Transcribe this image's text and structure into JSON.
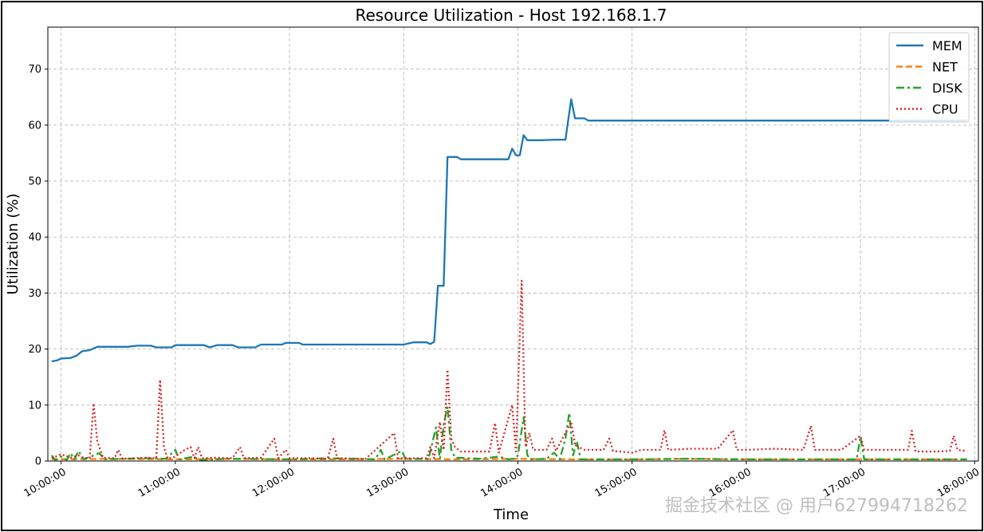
{
  "chart_data": {
    "type": "line",
    "title": "Resource Utilization - Host 192.168.1.7",
    "xlabel": "Time",
    "ylabel": "Utilization (%)",
    "ylim": [
      0,
      77.5
    ],
    "xlim": [
      "09:53:00",
      "18:02:00"
    ],
    "yticks": [
      0,
      10,
      20,
      30,
      40,
      50,
      60,
      70
    ],
    "xticks": [
      "10:00:00",
      "11:00:00",
      "12:00:00",
      "13:00:00",
      "14:00:00",
      "15:00:00",
      "16:00:00",
      "17:00:00",
      "18:00:00"
    ],
    "grid": true,
    "legend_position": "top-right",
    "series": [
      {
        "name": "MEM",
        "color": "#1f77b4",
        "style": "solid",
        "points": [
          [
            "09:55:00",
            17.8
          ],
          [
            "09:58:00",
            18.0
          ],
          [
            "10:00:00",
            18.3
          ],
          [
            "10:05:00",
            18.4
          ],
          [
            "10:08:00",
            18.8
          ],
          [
            "10:11:00",
            19.6
          ],
          [
            "10:15:00",
            19.8
          ],
          [
            "10:19:00",
            20.4
          ],
          [
            "10:25:00",
            20.4
          ],
          [
            "10:35:00",
            20.4
          ],
          [
            "10:40:00",
            20.6
          ],
          [
            "10:47:00",
            20.6
          ],
          [
            "10:50:00",
            20.3
          ],
          [
            "10:58:00",
            20.3
          ],
          [
            "11:00:00",
            20.7
          ],
          [
            "11:15:00",
            20.7
          ],
          [
            "11:18:00",
            20.3
          ],
          [
            "11:22:00",
            20.7
          ],
          [
            "11:30:00",
            20.7
          ],
          [
            "11:33:00",
            20.3
          ],
          [
            "11:42:00",
            20.3
          ],
          [
            "11:45:00",
            20.8
          ],
          [
            "11:56:00",
            20.8
          ],
          [
            "11:58:00",
            21.1
          ],
          [
            "12:05:00",
            21.1
          ],
          [
            "12:07:00",
            20.8
          ],
          [
            "12:30:00",
            20.8
          ],
          [
            "13:00:00",
            20.8
          ],
          [
            "13:05:00",
            21.2
          ],
          [
            "13:12:00",
            21.2
          ],
          [
            "13:14:00",
            20.9
          ],
          [
            "13:16:00",
            21.3
          ],
          [
            "13:18:00",
            31.3
          ],
          [
            "13:21:00",
            31.3
          ],
          [
            "13:23:00",
            54.3
          ],
          [
            "13:28:00",
            54.3
          ],
          [
            "13:30:00",
            53.9
          ],
          [
            "13:55:00",
            53.9
          ],
          [
            "13:57:00",
            55.8
          ],
          [
            "13:59:00",
            54.6
          ],
          [
            "14:01:00",
            54.6
          ],
          [
            "14:03:00",
            58.2
          ],
          [
            "14:05:00",
            57.3
          ],
          [
            "14:12:00",
            57.3
          ],
          [
            "14:20:00",
            57.4
          ],
          [
            "14:25:00",
            57.4
          ],
          [
            "14:28:00",
            64.6
          ],
          [
            "14:30:00",
            61.2
          ],
          [
            "14:35:00",
            61.2
          ],
          [
            "14:37:00",
            60.8
          ],
          [
            "15:00:00",
            60.8
          ],
          [
            "15:30:00",
            60.8
          ],
          [
            "16:00:00",
            60.8
          ],
          [
            "16:30:00",
            60.8
          ],
          [
            "17:00:00",
            60.8
          ],
          [
            "17:30:00",
            60.8
          ],
          [
            "17:56:00",
            60.8
          ]
        ]
      },
      {
        "name": "NET",
        "color": "#ff7f0e",
        "style": "dashed",
        "points": [
          [
            "09:55:00",
            0.3
          ],
          [
            "10:30:00",
            0.4
          ],
          [
            "11:00:00",
            0.3
          ],
          [
            "11:30:00",
            0.4
          ],
          [
            "12:00:00",
            0.3
          ],
          [
            "12:30:00",
            0.3
          ],
          [
            "13:00:00",
            0.4
          ],
          [
            "13:30:00",
            0.3
          ],
          [
            "14:00:00",
            0.4
          ],
          [
            "14:30:00",
            0.3
          ],
          [
            "15:00:00",
            0.3
          ],
          [
            "15:30:00",
            0.4
          ],
          [
            "16:00:00",
            0.3
          ],
          [
            "16:30:00",
            0.3
          ],
          [
            "17:00:00",
            0.3
          ],
          [
            "17:30:00",
            0.3
          ],
          [
            "17:56:00",
            0.3
          ]
        ]
      },
      {
        "name": "DISK",
        "color": "#2ca02c",
        "style": "dashdot",
        "points": [
          [
            "09:55:00",
            1.0
          ],
          [
            "09:57:00",
            0.2
          ],
          [
            "10:00:00",
            0.8
          ],
          [
            "10:03:00",
            0.2
          ],
          [
            "10:05:00",
            1.4
          ],
          [
            "10:07:00",
            0.3
          ],
          [
            "10:09:00",
            1.8
          ],
          [
            "10:12:00",
            0.3
          ],
          [
            "10:20:00",
            1.4
          ],
          [
            "10:23:00",
            0.3
          ],
          [
            "10:45:00",
            0.5
          ],
          [
            "10:55:00",
            0.4
          ],
          [
            "11:00:00",
            2.0
          ],
          [
            "11:02:00",
            0.3
          ],
          [
            "11:10:00",
            0.8
          ],
          [
            "11:12:00",
            0.2
          ],
          [
            "11:30:00",
            0.4
          ],
          [
            "12:00:00",
            0.3
          ],
          [
            "12:20:00",
            0.5
          ],
          [
            "12:45:00",
            0.3
          ],
          [
            "12:48:00",
            2.0
          ],
          [
            "12:50:00",
            0.3
          ],
          [
            "12:59:00",
            1.8
          ],
          [
            "13:01:00",
            0.3
          ],
          [
            "13:10:00",
            0.4
          ],
          [
            "13:13:00",
            0.3
          ],
          [
            "13:17:00",
            6.0
          ],
          [
            "13:19:00",
            0.4
          ],
          [
            "13:21:00",
            6.5
          ],
          [
            "13:23:00",
            9.7
          ],
          [
            "13:25:00",
            2.0
          ],
          [
            "13:27:00",
            0.6
          ],
          [
            "13:40:00",
            0.4
          ],
          [
            "13:50:00",
            0.8
          ],
          [
            "13:55:00",
            0.3
          ],
          [
            "13:58:00",
            0.4
          ],
          [
            "14:00:00",
            1.0
          ],
          [
            "14:03:00",
            7.8
          ],
          [
            "14:05:00",
            1.0
          ],
          [
            "14:07:00",
            0.3
          ],
          [
            "14:15:00",
            0.4
          ],
          [
            "14:19:00",
            1.5
          ],
          [
            "14:22:00",
            0.3
          ],
          [
            "14:25:00",
            4.0
          ],
          [
            "14:27:00",
            8.6
          ],
          [
            "14:29:00",
            1.0
          ],
          [
            "14:31:00",
            3.5
          ],
          [
            "14:33:00",
            0.3
          ],
          [
            "15:00:00",
            0.3
          ],
          [
            "15:30:00",
            0.4
          ],
          [
            "16:00:00",
            0.3
          ],
          [
            "16:30:00",
            0.3
          ],
          [
            "16:58:00",
            0.3
          ],
          [
            "17:00:00",
            4.3
          ],
          [
            "17:02:00",
            0.3
          ],
          [
            "17:30:00",
            0.3
          ],
          [
            "17:56:00",
            0.3
          ]
        ]
      },
      {
        "name": "CPU",
        "color": "#d62728",
        "style": "dotted",
        "points": [
          [
            "09:55:00",
            0.5
          ],
          [
            "10:00:00",
            1.2
          ],
          [
            "10:05:00",
            0.6
          ],
          [
            "10:09:00",
            1.0
          ],
          [
            "10:12:00",
            0.5
          ],
          [
            "10:15:00",
            0.6
          ],
          [
            "10:17:00",
            10.3
          ],
          [
            "10:19:00",
            3.5
          ],
          [
            "10:22:00",
            0.6
          ],
          [
            "10:28:00",
            0.5
          ],
          [
            "10:30:00",
            2.0
          ],
          [
            "10:32:00",
            0.4
          ],
          [
            "10:45:00",
            0.6
          ],
          [
            "10:50:00",
            0.5
          ],
          [
            "10:52:00",
            14.5
          ],
          [
            "10:54:00",
            2.5
          ],
          [
            "10:56:00",
            0.4
          ],
          [
            "11:00:00",
            0.8
          ],
          [
            "11:05:00",
            2.0
          ],
          [
            "11:08:00",
            2.5
          ],
          [
            "11:10:00",
            0.5
          ],
          [
            "11:12:00",
            2.5
          ],
          [
            "11:14:00",
            0.5
          ],
          [
            "11:20:00",
            0.6
          ],
          [
            "11:30:00",
            0.5
          ],
          [
            "11:34:00",
            2.5
          ],
          [
            "11:36:00",
            0.5
          ],
          [
            "11:45:00",
            0.6
          ],
          [
            "11:52:00",
            4.0
          ],
          [
            "11:54:00",
            0.5
          ],
          [
            "11:58:00",
            2.0
          ],
          [
            "12:00:00",
            0.5
          ],
          [
            "12:10:00",
            0.5
          ],
          [
            "12:20:00",
            0.4
          ],
          [
            "12:23:00",
            4.0
          ],
          [
            "12:25:00",
            0.5
          ],
          [
            "12:40:00",
            0.4
          ],
          [
            "12:55:00",
            5.0
          ],
          [
            "12:57:00",
            0.5
          ],
          [
            "13:05:00",
            0.5
          ],
          [
            "13:12:00",
            0.5
          ],
          [
            "13:14:00",
            2.5
          ],
          [
            "13:16:00",
            0.5
          ],
          [
            "13:19:00",
            7.0
          ],
          [
            "13:21:00",
            2.0
          ],
          [
            "13:23:00",
            16.3
          ],
          [
            "13:25:00",
            4.0
          ],
          [
            "13:27:00",
            2.5
          ],
          [
            "13:30:00",
            1.7
          ],
          [
            "13:45:00",
            1.7
          ],
          [
            "13:48:00",
            6.8
          ],
          [
            "13:50:00",
            1.5
          ],
          [
            "13:57:00",
            10.0
          ],
          [
            "13:59:00",
            1.7
          ],
          [
            "14:02:00",
            32.2
          ],
          [
            "14:04:00",
            2.5
          ],
          [
            "14:06:00",
            5.0
          ],
          [
            "14:08:00",
            2.0
          ],
          [
            "14:15:00",
            2.0
          ],
          [
            "14:18:00",
            4.0
          ],
          [
            "14:20:00",
            1.8
          ],
          [
            "14:28:00",
            7.0
          ],
          [
            "14:30:00",
            3.0
          ],
          [
            "14:32:00",
            2.5
          ],
          [
            "14:35:00",
            2.0
          ],
          [
            "14:45:00",
            2.0
          ],
          [
            "14:48:00",
            4.0
          ],
          [
            "14:50:00",
            1.8
          ],
          [
            "15:00:00",
            1.5
          ],
          [
            "15:05:00",
            2.0
          ],
          [
            "15:15:00",
            2.0
          ],
          [
            "15:17:00",
            5.5
          ],
          [
            "15:19:00",
            2.0
          ],
          [
            "15:30:00",
            2.2
          ],
          [
            "15:45:00",
            2.2
          ],
          [
            "15:53:00",
            5.5
          ],
          [
            "15:55:00",
            2.0
          ],
          [
            "16:00:00",
            2.0
          ],
          [
            "16:15:00",
            2.2
          ],
          [
            "16:30:00",
            2.0
          ],
          [
            "16:34:00",
            6.3
          ],
          [
            "16:36:00",
            2.0
          ],
          [
            "16:50:00",
            2.0
          ],
          [
            "17:00:00",
            4.5
          ],
          [
            "17:02:00",
            2.0
          ],
          [
            "17:15:00",
            2.0
          ],
          [
            "17:25:00",
            2.0
          ],
          [
            "17:27:00",
            5.4
          ],
          [
            "17:29:00",
            1.7
          ],
          [
            "17:40:00",
            1.7
          ],
          [
            "17:47:00",
            1.8
          ],
          [
            "17:49:00",
            4.5
          ],
          [
            "17:51:00",
            2.0
          ],
          [
            "17:56:00",
            1.8
          ]
        ]
      }
    ]
  },
  "watermark": "掘金技术社区 @ 用户627994718262"
}
